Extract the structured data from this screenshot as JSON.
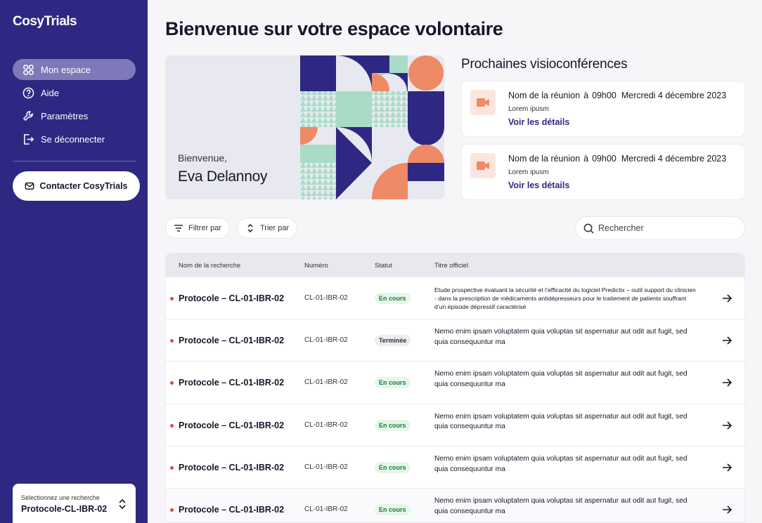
{
  "app": {
    "name": "CosyTrials"
  },
  "sidebar": {
    "items": [
      {
        "label": "Mon espace",
        "icon": "grid-icon",
        "active": true
      },
      {
        "label": "Aide",
        "icon": "help-icon",
        "active": false
      },
      {
        "label": "Paramètres",
        "icon": "wrench-icon",
        "active": false
      },
      {
        "label": "Se déconnecter",
        "icon": "logout-icon",
        "active": false
      }
    ],
    "contact_label": "Contacter CosyTrials",
    "select": {
      "label": "Sélectionnez une recherche",
      "value": "Protocole-CL-IBR-02"
    }
  },
  "page": {
    "title": "Bienvenue sur votre espace volontaire"
  },
  "banner": {
    "greeting": "Bienvenue,",
    "user_name": "Eva Delannoy"
  },
  "meetings": {
    "title": "Prochaines visioconférences",
    "items": [
      {
        "name": "Nom de la réunion",
        "at": "à",
        "time": "09h00",
        "date": "Mercredi 4 décembre 2023",
        "desc": "Lorem ipusm",
        "link": "Voir les détails"
      },
      {
        "name": "Nom de la réunion",
        "at": "à",
        "time": "09h00",
        "date": "Mercredi 4 décembre 2023",
        "desc": "Lorem ipusm",
        "link": "Voir les détails"
      }
    ]
  },
  "toolbar": {
    "filter_label": "Filtrer par",
    "sort_label": "Trier par",
    "search_placeholder": "Rechercher"
  },
  "table": {
    "headers": {
      "name": "Nom de la recherche",
      "number": "Numéro",
      "status": "Statut",
      "title": "Titre officiel"
    },
    "rows": [
      {
        "name": "Protocole – CL-01-IBR-02",
        "number": "CL-01-IBR-02",
        "status": "En cours",
        "status_type": "ongoing",
        "title": "Etude prospective évaluant la sécurité et l’efficacité du logiciel Predictix – outil support du clinicien - dans la prescription de médicaments antidépresseurs pour le traitement de patients souffrant d’un épisode dépressif caractérisé"
      },
      {
        "name": "Protocole – CL-01-IBR-02",
        "number": "CL-01-IBR-02",
        "status": "Terminée",
        "status_type": "done",
        "title": "Nemo enim ipsam voluptatem quia voluptas sit aspernatur aut odit aut fugit, sed quia consequuntur ma"
      },
      {
        "name": "Protocole – CL-01-IBR-02",
        "number": "CL-01-IBR-02",
        "status": "En cours",
        "status_type": "ongoing",
        "title": "Nemo enim ipsam voluptatem quia voluptas sit aspernatur aut odit aut fugit, sed quia consequuntur ma"
      },
      {
        "name": "Protocole – CL-01-IBR-02",
        "number": "CL-01-IBR-02",
        "status": "En cours",
        "status_type": "ongoing",
        "title": "Nemo enim ipsam voluptatem quia voluptas sit aspernatur aut odit aut fugit, sed quia consequuntur ma"
      },
      {
        "name": "Protocole – CL-01-IBR-02",
        "number": "CL-01-IBR-02",
        "status": "En cours",
        "status_type": "ongoing",
        "title": "Nemo enim ipsam voluptatem quia voluptas sit aspernatur aut odit aut fugit, sed quia consequuntur ma"
      },
      {
        "name": "Protocole – CL-01-IBR-02",
        "number": "CL-01-IBR-02",
        "status": "En cours",
        "status_type": "ongoing",
        "title": "Nemo enim ipsam voluptatem quia voluptas sit aspernatur aut odit aut fugit, sed quia consequuntur ma"
      }
    ]
  },
  "colors": {
    "sidebar": "#2e2882",
    "active_nav": "#7e7ab9",
    "accent_orange": "#ee8a66",
    "mint": "#a8dcc6",
    "status_dot": "#e64545"
  }
}
